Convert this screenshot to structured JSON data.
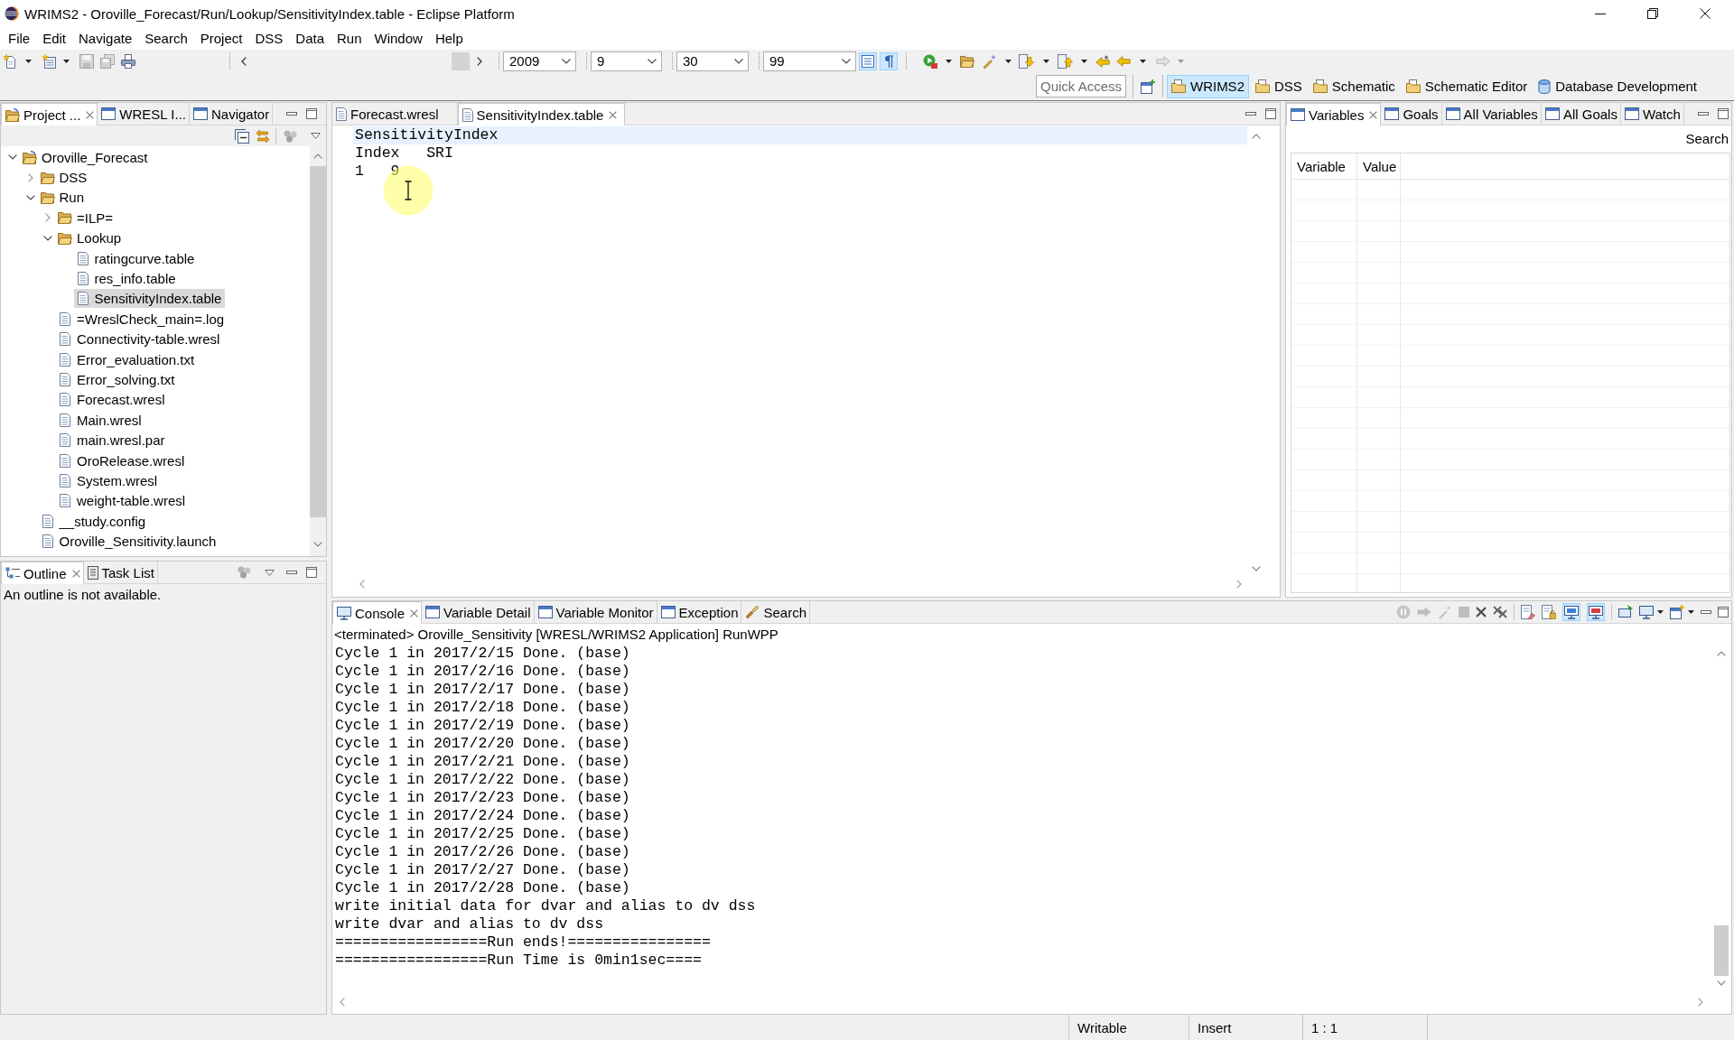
{
  "window": {
    "title": "WRIMS2 - Oroville_Forecast/Run/Lookup/SensitivityIndex.table - Eclipse Platform"
  },
  "menu": [
    "File",
    "Edit",
    "Navigate",
    "Search",
    "Project",
    "DSS",
    "Data",
    "Run",
    "Window",
    "Help"
  ],
  "toolbar": {
    "combos": [
      {
        "value": "2009"
      },
      {
        "value": "9"
      },
      {
        "value": "30"
      },
      {
        "value": "99"
      }
    ],
    "toggles": [
      {
        "kind": "block-selection",
        "on": true
      },
      {
        "kind": "whitespace",
        "on": true
      }
    ]
  },
  "quick_access": {
    "placeholder": "Quick Access"
  },
  "perspectives": [
    {
      "label": "WRIMS2",
      "kind": "folder",
      "selected": true
    },
    {
      "label": "DSS",
      "kind": "folder",
      "selected": false
    },
    {
      "label": "Schematic",
      "kind": "folder",
      "selected": false
    },
    {
      "label": "Schematic Editor",
      "kind": "folder",
      "selected": false
    },
    {
      "label": "Database Development",
      "kind": "database",
      "selected": false
    }
  ],
  "project_view": {
    "tabs": [
      {
        "label": "Project ...",
        "kind": "project",
        "selected": true
      },
      {
        "label": "WRESL I...",
        "kind": "window",
        "selected": false
      },
      {
        "label": "Navigator",
        "kind": "window",
        "selected": false
      }
    ],
    "tree": [
      {
        "label": "Oroville_Forecast",
        "kind": "project",
        "expanded": true,
        "selected": false,
        "children": [
          {
            "label": "DSS",
            "kind": "folder",
            "expanded": false,
            "selected": false
          },
          {
            "label": "Run",
            "kind": "folder",
            "expanded": true,
            "selected": false,
            "children": [
              {
                "label": "=ILP=",
                "kind": "folder",
                "expanded": false,
                "selected": false
              },
              {
                "label": "Lookup",
                "kind": "folder",
                "expanded": true,
                "selected": false,
                "children": [
                  {
                    "label": "ratingcurve.table",
                    "kind": "file",
                    "selected": false
                  },
                  {
                    "label": "res_info.table",
                    "kind": "file",
                    "selected": false
                  },
                  {
                    "label": "SensitivityIndex.table",
                    "kind": "file",
                    "selected": true
                  }
                ]
              },
              {
                "label": "=WreslCheck_main=.log",
                "kind": "file",
                "selected": false
              },
              {
                "label": "Connectivity-table.wresl",
                "kind": "file",
                "selected": false
              },
              {
                "label": "Error_evaluation.txt",
                "kind": "file",
                "selected": false
              },
              {
                "label": "Error_solving.txt",
                "kind": "file",
                "selected": false
              },
              {
                "label": "Forecast.wresl",
                "kind": "file",
                "selected": false
              },
              {
                "label": "Main.wresl",
                "kind": "file",
                "selected": false
              },
              {
                "label": "main.wresl.par",
                "kind": "file",
                "selected": false
              },
              {
                "label": "OroRelease.wresl",
                "kind": "file",
                "selected": false
              },
              {
                "label": "System.wresl",
                "kind": "file",
                "selected": false
              },
              {
                "label": "weight-table.wresl",
                "kind": "file",
                "selected": false
              }
            ]
          },
          {
            "label": "__study.config",
            "kind": "file",
            "selected": false
          },
          {
            "label": "Oroville_Sensitivity.launch",
            "kind": "file",
            "selected": false
          }
        ]
      }
    ]
  },
  "outline_view": {
    "tabs": [
      {
        "label": "Outline",
        "kind": "outline",
        "selected": true
      },
      {
        "label": "Task List",
        "kind": "tasks",
        "selected": false
      }
    ],
    "message": "An outline is not available."
  },
  "editor": {
    "tabs": [
      {
        "label": "Forecast.wresl",
        "kind": "file",
        "selected": false
      },
      {
        "label": "SensitivityIndex.table",
        "kind": "file",
        "selected": true
      }
    ],
    "lines": [
      {
        "text": "SensitivityIndex",
        "current": true
      },
      {
        "text": "Index   SRI",
        "current": false
      },
      {
        "text": "1   9",
        "current": false
      }
    ]
  },
  "variables_view": {
    "tabs": [
      {
        "label": "Variables",
        "kind": "window",
        "selected": true
      },
      {
        "label": "Goals",
        "kind": "window",
        "selected": false
      },
      {
        "label": "All Variables",
        "kind": "window",
        "selected": false
      },
      {
        "label": "All Goals",
        "kind": "window",
        "selected": false
      },
      {
        "label": "Watch",
        "kind": "window",
        "selected": false
      }
    ],
    "search_button": "Search",
    "columns": [
      "Variable",
      "Value"
    ]
  },
  "console": {
    "tabs": [
      {
        "label": "Console",
        "kind": "console",
        "selected": true
      },
      {
        "label": "Variable Detail",
        "kind": "window",
        "selected": false
      },
      {
        "label": "Variable Monitor",
        "kind": "window",
        "selected": false
      },
      {
        "label": "Exception",
        "kind": "window",
        "selected": false
      },
      {
        "label": "Search",
        "kind": "search",
        "selected": false
      }
    ],
    "toolbar_toggles": [
      {
        "kind": "stdout",
        "on": true
      },
      {
        "kind": "stderr",
        "on": true
      }
    ],
    "header": "<terminated> Oroville_Sensitivity [WRESL/WRIMS2 Application] RunWPP",
    "lines": [
      "Cycle 1 in 2017/2/15 Done. (base)",
      "Cycle 1 in 2017/2/16 Done. (base)",
      "Cycle 1 in 2017/2/17 Done. (base)",
      "Cycle 1 in 2017/2/18 Done. (base)",
      "Cycle 1 in 2017/2/19 Done. (base)",
      "Cycle 1 in 2017/2/20 Done. (base)",
      "Cycle 1 in 2017/2/21 Done. (base)",
      "Cycle 1 in 2017/2/22 Done. (base)",
      "Cycle 1 in 2017/2/23 Done. (base)",
      "Cycle 1 in 2017/2/24 Done. (base)",
      "Cycle 1 in 2017/2/25 Done. (base)",
      "Cycle 1 in 2017/2/26 Done. (base)",
      "Cycle 1 in 2017/2/27 Done. (base)",
      "Cycle 1 in 2017/2/28 Done. (base)",
      "write initial data for dvar and alias to dv dss",
      "write dvar and alias to dv dss",
      "=================Run ends!================",
      "=================Run Time is 0min1sec===="
    ]
  },
  "status_bar": [
    "Writable",
    "Insert",
    "1 : 1"
  ]
}
